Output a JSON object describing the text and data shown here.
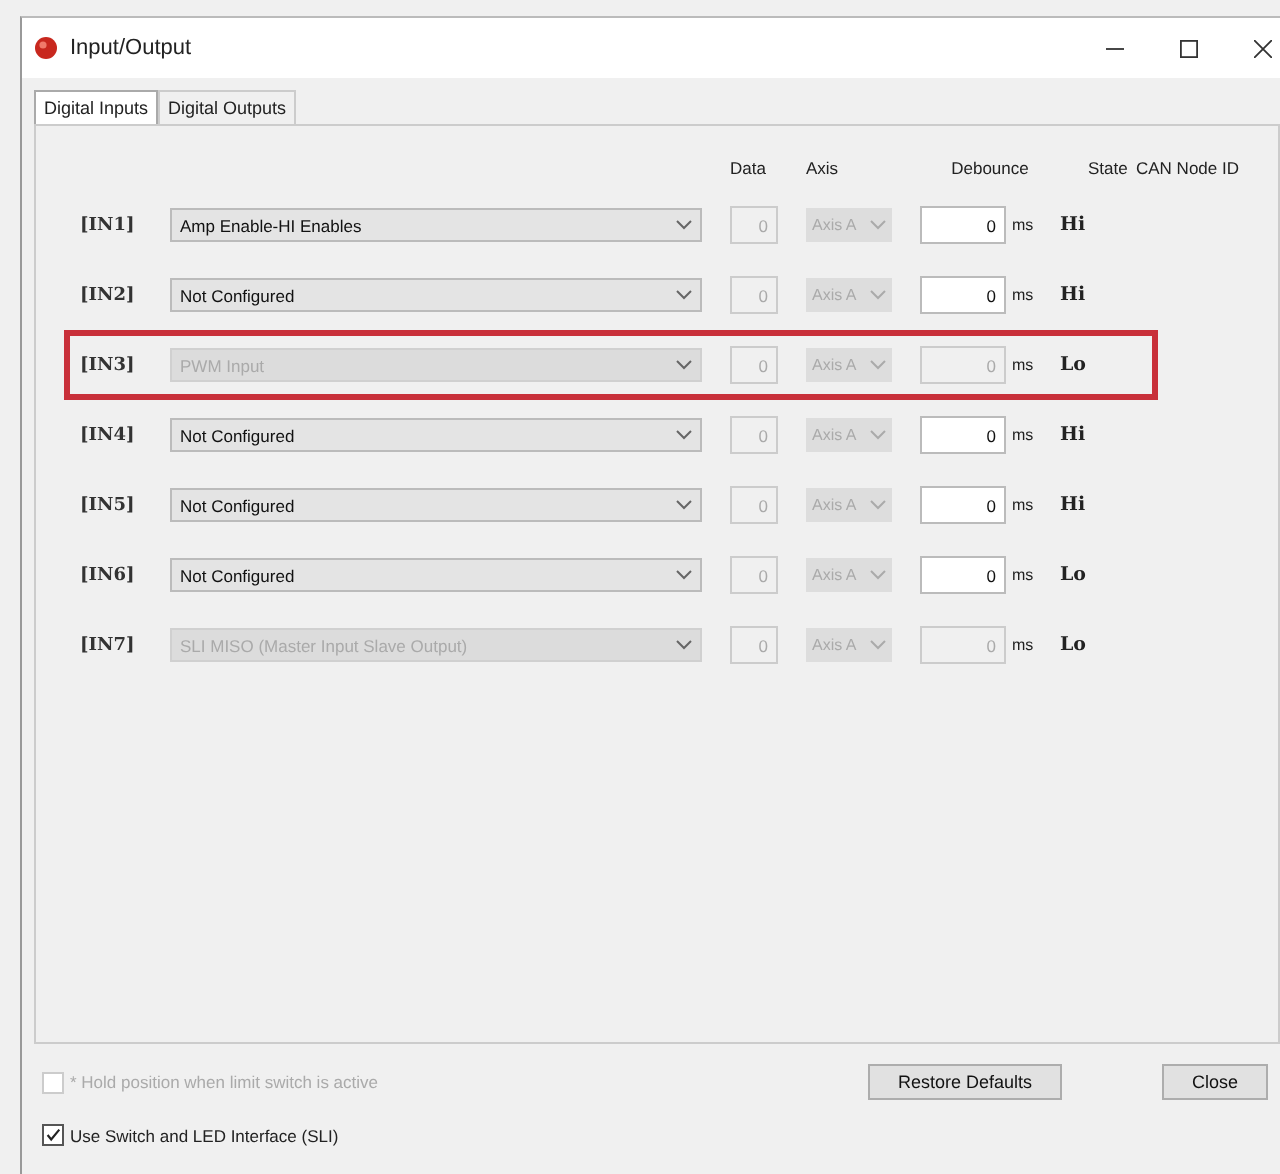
{
  "window": {
    "title": "Input/Output"
  },
  "tabs": [
    {
      "label": "Digital Inputs",
      "selected": true
    },
    {
      "label": "Digital Outputs",
      "selected": false
    }
  ],
  "columns": {
    "data": "Data",
    "axis": "Axis",
    "debounce": "Debounce",
    "state": "State",
    "can_node_id": "CAN Node ID"
  },
  "inputs": [
    {
      "label": "[IN1]",
      "function": "Amp Enable-HI Enables",
      "disabled": false,
      "highlighted": false,
      "data": "0",
      "axis": "Axis A",
      "debounce": "0",
      "unit": "ms",
      "state": "Hi"
    },
    {
      "label": "[IN2]",
      "function": "Not Configured",
      "disabled": false,
      "highlighted": false,
      "data": "0",
      "axis": "Axis A",
      "debounce": "0",
      "unit": "ms",
      "state": "Hi"
    },
    {
      "label": "[IN3]",
      "function": "PWM Input",
      "disabled": true,
      "highlighted": true,
      "data": "0",
      "axis": "Axis A",
      "debounce": "0",
      "unit": "ms",
      "state": "Lo"
    },
    {
      "label": "[IN4]",
      "function": "Not Configured",
      "disabled": false,
      "highlighted": false,
      "data": "0",
      "axis": "Axis A",
      "debounce": "0",
      "unit": "ms",
      "state": "Hi"
    },
    {
      "label": "[IN5]",
      "function": "Not Configured",
      "disabled": false,
      "highlighted": false,
      "data": "0",
      "axis": "Axis A",
      "debounce": "0",
      "unit": "ms",
      "state": "Hi"
    },
    {
      "label": "[IN6]",
      "function": "Not Configured",
      "disabled": false,
      "highlighted": false,
      "data": "0",
      "axis": "Axis A",
      "debounce": "0",
      "unit": "ms",
      "state": "Lo"
    },
    {
      "label": "[IN7]",
      "function": "SLI MISO (Master Input Slave Output)",
      "disabled": true,
      "highlighted": false,
      "data": "0",
      "axis": "Axis A",
      "debounce": "0",
      "unit": "ms",
      "state": "Lo"
    }
  ],
  "options": [
    {
      "label": "* Hold position when limit switch is active",
      "checked": false,
      "disabled": true
    },
    {
      "label": "Use Switch and LED Interface (SLI)",
      "checked": true,
      "disabled": false
    }
  ],
  "buttons": [
    "Restore Defaults",
    "Close"
  ]
}
